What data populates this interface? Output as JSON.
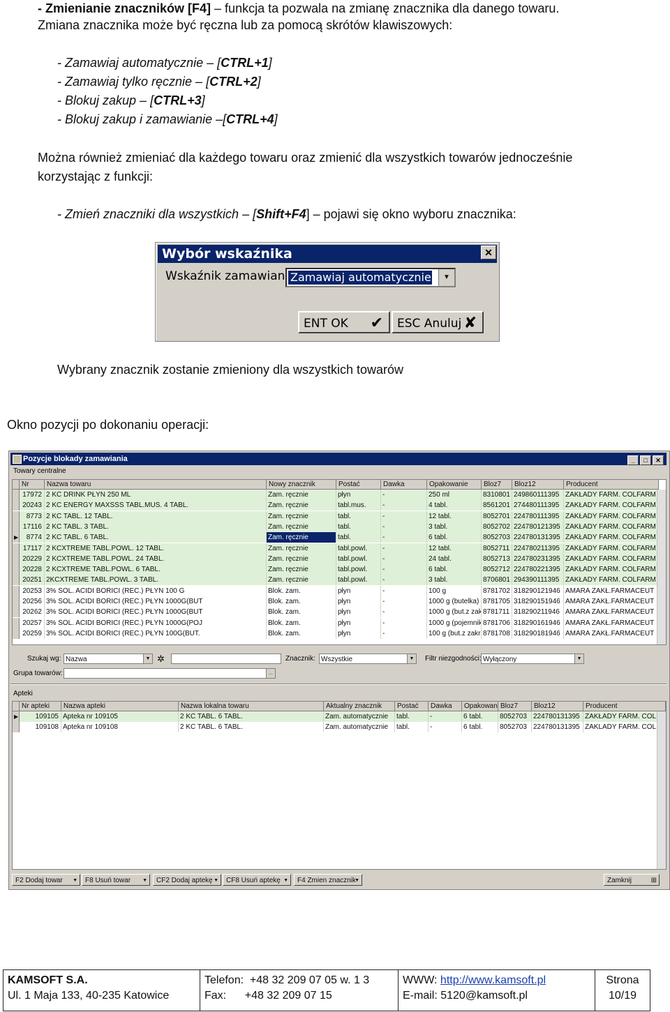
{
  "intro": {
    "line1_bold": "- Zmienianie znaczników [F4]",
    "line1_rest": " – funkcja ta pozwala na zmianę znacznika dla danego towaru.",
    "line2": "Zmiana znacznika może być ręczna lub za pomocą skrótów klawiszowych:"
  },
  "shortcuts": [
    {
      "text": "- Zamawiaj automatycznie – [",
      "key": "CTRL+1",
      "end": "]"
    },
    {
      "text": "- Zamawiaj tylko ręcznie – [",
      "key": "CTRL+2",
      "end": "]"
    },
    {
      "text": "- Blokuj zakup – [",
      "key": "CTRL+3",
      "end": "]"
    },
    {
      "text": "- Blokuj zakup i zamawianie –[",
      "key": "CTRL+4",
      "end": "]"
    }
  ],
  "para1_line1": "Można również zmieniać dla każdego towaru oraz zmienić dla wszystkich towarów jednocześnie",
  "para1_line2": "korzystając z funkcji:",
  "change_all": {
    "text": "- Zmień znaczniki dla wszystkich – [",
    "key": "Shift+F4",
    "end": "] – pojawi się okno wyboru znacznika:"
  },
  "dialog": {
    "title": "Wybór wskaźnika",
    "label": "Wskaźnik zamawiania:",
    "value": "Zamawiaj automatycznie",
    "ok": "ENT OK",
    "cancel": "ESC Anuluj"
  },
  "after_dialog": "Wybrany znacznik zostanie zmieniony dla wszystkich towarów",
  "window_caption": "Okno pozycji po dokonaniu operacji:",
  "window": {
    "title": "Pozycje blokady zamawiania",
    "section1": "Towary centralne",
    "columns": [
      "Nr",
      "Nazwa towaru",
      "Nowy znacznik",
      "Postać",
      "Dawka",
      "Opakowanie",
      "Bloz7",
      "Bloz12",
      "Producent"
    ],
    "rows": [
      [
        "17972",
        "2 KC DRINK PŁYN 250 ML",
        "Zam. ręcznie",
        "płyn",
        "-",
        "250 ml",
        "8310801",
        "249860111395",
        "ZAKŁADY FARM. COLFARM"
      ],
      [
        "20243",
        "2 KC ENERGY MAXSSS TABL.MUS. 4 TABL.",
        "Zam. ręcznie",
        "tabl.mus.",
        "-",
        "4 tabl.",
        "8561201",
        "274480111395",
        "ZAKŁADY FARM. COLFARM"
      ],
      [
        "8773",
        "2 KC TABL. 12 TABL.",
        "Zam. ręcznie",
        "tabl.",
        "-",
        "12 tabl.",
        "8052701",
        "224780111395",
        "ZAKŁADY FARM. COLFARM"
      ],
      [
        "17116",
        "2 KC TABL. 3 TABL.",
        "Zam. ręcznie",
        "tabl.",
        "-",
        "3 tabl.",
        "8052702",
        "224780121395",
        "ZAKŁADY FARM. COLFARM"
      ],
      [
        "8774",
        "2 KC TABL. 6 TABL.",
        "Zam. ręcznie",
        "tabl.",
        "-",
        "6 tabl.",
        "8052703",
        "224780131395",
        "ZAKŁADY FARM. COLFARM"
      ],
      [
        "17117",
        "2 KCXTREME TABL.POWL. 12 TABL.",
        "Zam. ręcznie",
        "tabl.powl.",
        "-",
        "12 tabl.",
        "8052711",
        "224780211395",
        "ZAKŁADY FARM. COLFARM"
      ],
      [
        "20229",
        "2 KCXTREME TABL.POWL. 24 TABL.",
        "Zam. ręcznie",
        "tabl.powl.",
        "-",
        "24 tabl.",
        "8052713",
        "224780231395",
        "ZAKŁADY FARM. COLFARM"
      ],
      [
        "20228",
        "2 KCXTREME TABL.POWL. 6 TABL.",
        "Zam. ręcznie",
        "tabl.powl.",
        "-",
        "6 tabl.",
        "8052712",
        "224780221395",
        "ZAKŁADY FARM. COLFARM"
      ],
      [
        "20251",
        "2KCXTREME TABL.POWL. 3 TABL.",
        "Zam. ręcznie",
        "tabl.powl.",
        "-",
        "3 tabl.",
        "8706801",
        "294390111395",
        "ZAKŁADY FARM. COLFARM"
      ],
      [
        "20253",
        "3% SOL. ACIDI BORICI (REC.) PŁYN 100 G",
        "Blok. zam.",
        "płyn",
        "-",
        "100 g",
        "8781702",
        "318290121946",
        "AMARA ZAKŁ.FARMACEUT"
      ],
      [
        "20256",
        "3% SOL. ACIDI BORICI (REC.) PŁYN 1000G(BUT",
        "Blok. zam.",
        "płyn",
        "-",
        "1000 g (butelka)",
        "8781705",
        "318290151946",
        "AMARA ZAKŁ.FARMACEUT"
      ],
      [
        "20262",
        "3% SOL. ACIDI BORICI (REC.) PŁYN 1000G(BUT",
        "Blok. zam.",
        "płyn",
        "-",
        "1000 g (but.z zakr",
        "8781711",
        "318290211946",
        "AMARA ZAKŁ.FARMACEUT"
      ],
      [
        "20257",
        "3% SOL. ACIDI BORICI (REC.) PŁYN 1000G(POJ",
        "Blok. zam.",
        "płyn",
        "-",
        "1000 g (pojemnik)",
        "8781706",
        "318290161946",
        "AMARA ZAKŁ.FARMACEUT"
      ],
      [
        "20259",
        "3% SOL. ACIDI BORICI (REC.) PŁYN 100G(BUT.",
        "Blok. zam.",
        "płyn",
        "-",
        "100 g (but.z zakr.",
        "8781708",
        "318290181946",
        "AMARA ZAKŁ.FARMACEUT"
      ]
    ],
    "search_label": "Szukaj wg:",
    "search_by": "Nazwa",
    "marker_label": "Znacznik:",
    "marker_value": "Wszystkie",
    "filter_label": "Filtr niezgodności:",
    "filter_value": "Wyłączony",
    "group_label": "Grupa towarów:",
    "section2": "Apteki",
    "columns2": [
      "Nr apteki",
      "Nazwa apteki",
      "Nazwa lokalna towaru",
      "Aktualny znacznik",
      "Postać",
      "Dawka",
      "Opakowanie",
      "Bloz7",
      "Bloz12",
      "Producent"
    ],
    "rows2": [
      [
        "109105",
        "Apteka nr 109105",
        "2 KC TABL. 6 TABL.",
        "Zam. automatycznie",
        "tabl.",
        "-",
        "6 tabl.",
        "8052703",
        "224780131395",
        "ZAKŁADY FARM. COLI"
      ],
      [
        "109108",
        "Apteka nr 109108",
        "2 KC TABL. 6 TABL.",
        "Zam. automatycznie",
        "tabl.",
        "-",
        "6 tabl.",
        "8052703",
        "224780131395",
        "ZAKLADY FARM. COLI"
      ]
    ],
    "buttons": [
      "F2 Dodaj towar",
      "F8 Usuń towar",
      "CF2 Dodaj aptekę",
      "CF8 Usuń aptekę",
      "F4 Zmien znacznik"
    ],
    "close": "Zamknij"
  },
  "footer": {
    "company": "KAMSOFT S.A.",
    "address": "Ul. 1 Maja 133, 40-235 Katowice",
    "phone_label": "Telefon:",
    "phone": "+48 32 209 07 05 w. 1 3",
    "fax_label": "Fax:",
    "fax": "+48 32 209 07 15",
    "www_label": "WWW:",
    "www": "http://www.kamsoft.pl",
    "email": "E-mail: 5120@kamsoft.pl",
    "page_label": "Strona",
    "page": "10/19"
  }
}
